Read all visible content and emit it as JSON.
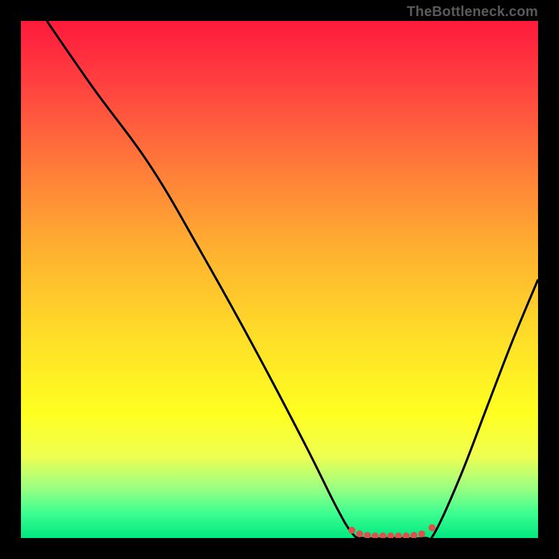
{
  "watermark": "TheBottleneck.com",
  "colors": {
    "frame": "#000000",
    "watermark": "#5a5a5a",
    "curve": "#000000",
    "dots": "#d9524c"
  },
  "chart_data": {
    "type": "line",
    "title": "",
    "xlabel": "",
    "ylabel": "",
    "xlim": [
      0,
      100
    ],
    "ylim": [
      0,
      100
    ],
    "gradient_stops": [
      {
        "pos": 0,
        "color": "#ff1a3c"
      },
      {
        "pos": 12,
        "color": "#ff4040"
      },
      {
        "pos": 28,
        "color": "#ff7a3a"
      },
      {
        "pos": 44,
        "color": "#ffb030"
      },
      {
        "pos": 62,
        "color": "#ffe028"
      },
      {
        "pos": 76,
        "color": "#ffff20"
      },
      {
        "pos": 84,
        "color": "#f0ff50"
      },
      {
        "pos": 90,
        "color": "#a0ff80"
      },
      {
        "pos": 95,
        "color": "#40ff90"
      },
      {
        "pos": 100,
        "color": "#00e880"
      }
    ],
    "series": [
      {
        "name": "curve",
        "points": [
          {
            "x": 5,
            "y": 100
          },
          {
            "x": 14,
            "y": 87
          },
          {
            "x": 25,
            "y": 72
          },
          {
            "x": 35,
            "y": 55
          },
          {
            "x": 45,
            "y": 37
          },
          {
            "x": 55,
            "y": 18
          },
          {
            "x": 61,
            "y": 6
          },
          {
            "x": 64,
            "y": 1
          },
          {
            "x": 66,
            "y": 0
          },
          {
            "x": 72,
            "y": 0
          },
          {
            "x": 78,
            "y": 0
          },
          {
            "x": 80,
            "y": 1
          },
          {
            "x": 85,
            "y": 12
          },
          {
            "x": 90,
            "y": 25
          },
          {
            "x": 95,
            "y": 38
          },
          {
            "x": 100,
            "y": 50
          }
        ]
      }
    ],
    "dots": [
      {
        "x": 64,
        "y": 1.5
      },
      {
        "x": 65.5,
        "y": 0.8
      },
      {
        "x": 67,
        "y": 0.5
      },
      {
        "x": 68.5,
        "y": 0.4
      },
      {
        "x": 70,
        "y": 0.4
      },
      {
        "x": 71.5,
        "y": 0.4
      },
      {
        "x": 73,
        "y": 0.4
      },
      {
        "x": 74.5,
        "y": 0.4
      },
      {
        "x": 76,
        "y": 0.5
      },
      {
        "x": 77.5,
        "y": 0.8
      },
      {
        "x": 79.5,
        "y": 2.0
      }
    ],
    "dot_radius_px": 5
  }
}
